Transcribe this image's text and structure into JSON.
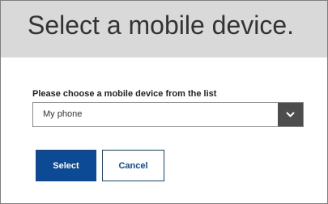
{
  "dialog": {
    "title": "Select a mobile device.",
    "field_label": "Please choose a mobile device from the list",
    "selected_device": "My phone",
    "select_label": "Select",
    "cancel_label": "Cancel"
  },
  "colors": {
    "header_bg": "#d9d9d9",
    "primary": "#0d4a96",
    "dropdown_arrow_bg": "#4d4d4d"
  },
  "icons": {
    "dropdown": "chevron-down-icon"
  }
}
